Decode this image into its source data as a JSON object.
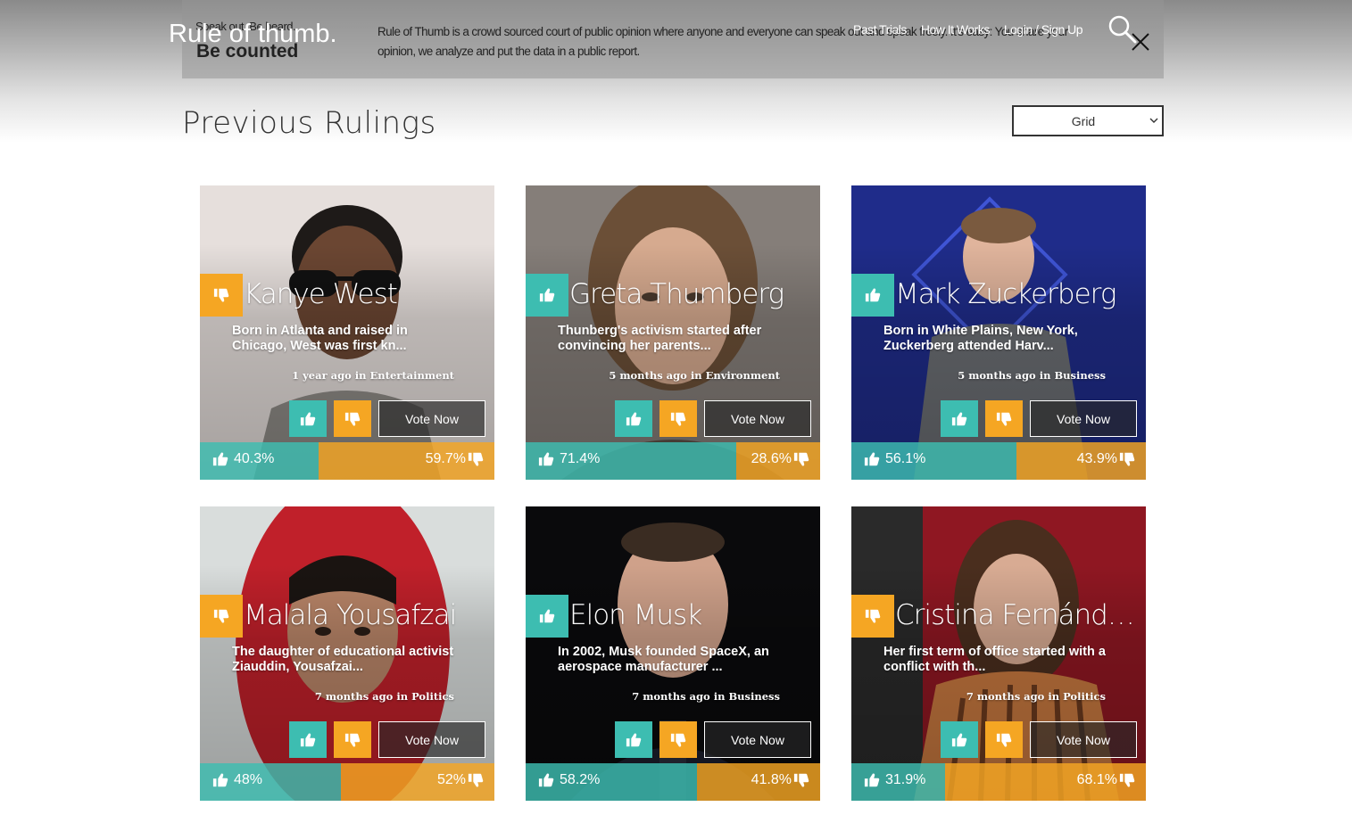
{
  "header": {
    "logo": "Rule of thumb.",
    "banner": {
      "speak_out": "Speak out. Be heard.",
      "be_counted": "Be counted",
      "text": "Rule of Thumb is a crowd sourced court of public opinion where anyone and everyone can speak out and speak freely. It's easy: You share your opinion, we analyze and put the data in a public report."
    },
    "nav": [
      "Past Trials",
      "How It Works",
      "Login / Sign Up"
    ],
    "icons": {
      "search": "search-icon",
      "close": "close-icon"
    }
  },
  "page": {
    "title": "Previous Rulings",
    "view_select": {
      "value": "Grid"
    }
  },
  "colors": {
    "positive": "#3dbdb1",
    "negative": "#f5a623"
  },
  "vote_now_label": "Vote Now",
  "cards": [
    {
      "name": "Kanye West",
      "description": "Born in Atlanta and raised in Chicago, West was first kn...",
      "meta": "1 year ago in Entertainment",
      "verdict": "negative",
      "positive": "40.3%",
      "negative": "59.7%",
      "positive_fraction": 0.403
    },
    {
      "name": "Greta Thumberg",
      "description": "Thunberg's activism started after convincing her parents...",
      "meta": "5 months ago in Environment",
      "verdict": "positive",
      "positive": "71.4%",
      "negative": "28.6%",
      "positive_fraction": 0.714
    },
    {
      "name": "Mark Zuckerberg",
      "description": "Born in White Plains, New York, Zuckerberg attended Harv...",
      "meta": "5 months ago in Business",
      "verdict": "positive",
      "positive": "56.1%",
      "negative": "43.9%",
      "positive_fraction": 0.561
    },
    {
      "name": "Malala Yousafzai",
      "description": "The daughter of educational activist Ziauddin, Yousafzai...",
      "meta": "7 months ago in Politics",
      "verdict": "negative",
      "positive": "48%",
      "negative": "52%",
      "positive_fraction": 0.48
    },
    {
      "name": "Elon Musk",
      "description": "In 2002, Musk founded SpaceX, an aerospace manufacturer ...",
      "meta": "7 months ago in Business",
      "verdict": "positive",
      "positive": "58.2%",
      "negative": "41.8%",
      "positive_fraction": 0.582
    },
    {
      "name": "Cristina Fernández de Kirchner",
      "description": "Her first term of office started with a conflict with th...",
      "meta": "7 months ago in Politics",
      "verdict": "negative",
      "positive": "31.9%",
      "negative": "68.1%",
      "positive_fraction": 0.319
    }
  ]
}
